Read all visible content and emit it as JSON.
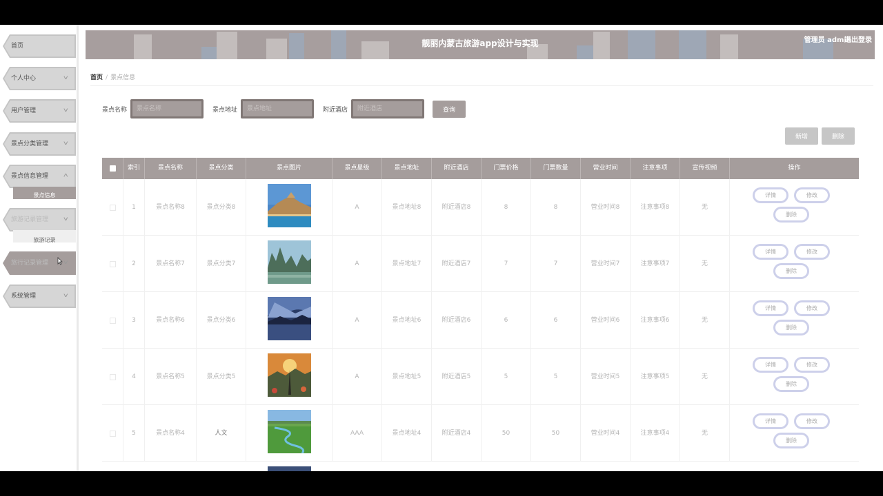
{
  "app": {
    "title": "靓丽内蒙古旅游app设计与实现",
    "user": "管理员 admin",
    "logout": "退出登录"
  },
  "sidebar": {
    "items": [
      {
        "label": "首页"
      },
      {
        "label": "个人中心"
      },
      {
        "label": "用户管理"
      },
      {
        "label": "景点分类管理"
      },
      {
        "label": "景点信息管理"
      },
      {
        "label": "旅游记录管理"
      },
      {
        "label": "旅行记录管理"
      },
      {
        "label": "系统管理"
      }
    ],
    "sub1": "景点信息",
    "sub2": "旅游记录",
    "chevron": "chevron-down-icon"
  },
  "breadcrumb": {
    "home": "首页",
    "current": "景点信息"
  },
  "search": {
    "name_label": "景点名称",
    "name_placeholder": "景点名称",
    "addr_label": "景点地址",
    "addr_placeholder": "景点地址",
    "hotel_label": "附近酒店",
    "hotel_placeholder": "附近酒店",
    "query": "查询"
  },
  "actions": {
    "add": "新增",
    "delete": "删除"
  },
  "table": {
    "headers": [
      "索引",
      "景点名称",
      "景点分类",
      "景点图片",
      "景点星级",
      "景点地址",
      "附近酒店",
      "门票价格",
      "门票数量",
      "营业时间",
      "注意事项",
      "宣传视频",
      "操作"
    ],
    "rows": [
      {
        "idx": "1",
        "name": "景点名称8",
        "cat": "景点分类8",
        "star": "A",
        "addr": "景点地址8",
        "hotel": "附近酒店8",
        "price": "8",
        "qty": "8",
        "hours": "营业时间8",
        "note": "注意事项8",
        "video": "无"
      },
      {
        "idx": "2",
        "name": "景点名称7",
        "cat": "景点分类7",
        "star": "A",
        "addr": "景点地址7",
        "hotel": "附近酒店7",
        "price": "7",
        "qty": "7",
        "hours": "营业时间7",
        "note": "注意事项7",
        "video": "无"
      },
      {
        "idx": "3",
        "name": "景点名称6",
        "cat": "景点分类6",
        "star": "A",
        "addr": "景点地址6",
        "hotel": "附近酒店6",
        "price": "6",
        "qty": "6",
        "hours": "营业时间6",
        "note": "注意事项6",
        "video": "无"
      },
      {
        "idx": "4",
        "name": "景点名称5",
        "cat": "景点分类5",
        "star": "A",
        "addr": "景点地址5",
        "hotel": "附近酒店5",
        "price": "5",
        "qty": "5",
        "hours": "营业时间5",
        "note": "注意事项5",
        "video": "无"
      },
      {
        "idx": "5",
        "name": "景点名称4",
        "cat": "人文",
        "star": "AAA",
        "addr": "景点地址4",
        "hotel": "附近酒店4",
        "price": "50",
        "qty": "50",
        "hours": "营业时间4",
        "note": "注意事项4",
        "video": "无"
      }
    ],
    "row_actions": {
      "detail": "详情",
      "edit": "修改",
      "delete": "删除"
    }
  }
}
